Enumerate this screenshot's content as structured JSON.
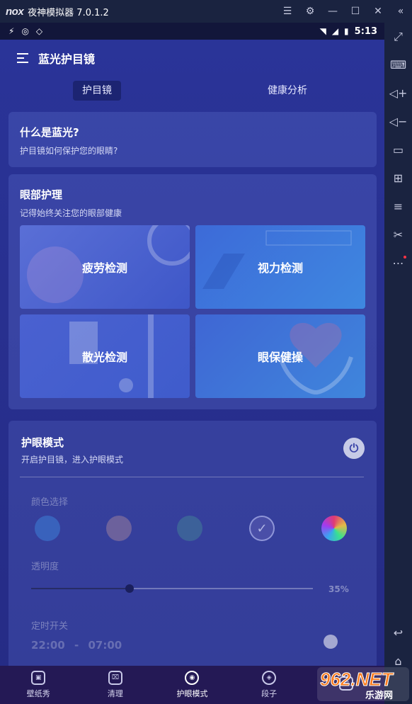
{
  "emulator": {
    "logo": "nox",
    "title": "夜神模拟器 7.0.1.2",
    "window_controls": [
      "menu-icon",
      "settings-icon",
      "minimize-icon",
      "maximize-icon",
      "close-icon",
      "collapse-icon"
    ],
    "side_tools": [
      "fullscreen-icon",
      "keyboard-icon",
      "volume-up-icon",
      "volume-down-icon",
      "screen-icon",
      "apk-install-icon",
      "multi-instance-icon",
      "cut-icon",
      "more-icon",
      "back-icon",
      "home-icon"
    ]
  },
  "status": {
    "time": "5:13"
  },
  "appbar": {
    "title": "蓝光护目镜"
  },
  "tabs": [
    {
      "label": "护目镜"
    },
    {
      "label": "健康分析"
    }
  ],
  "blue_light_card": {
    "title": "什么是蓝光?",
    "subtitle": "护目镜如何保护您的眼睛?"
  },
  "eye_care_card": {
    "title": "眼部护理",
    "subtitle": "记得始终关注您的眼部健康",
    "tiles": [
      {
        "label": "疲劳检测"
      },
      {
        "label": "视力检测"
      },
      {
        "label": "散光检测"
      },
      {
        "label": "眼保健操"
      }
    ]
  },
  "eye_mode_card": {
    "title": "护眼模式",
    "subtitle": "开启护目镜，进入护眼模式",
    "color_label": "颜色选择",
    "swatch_colors": [
      "#3b6cc4",
      "#7a6a9c",
      "#3f6a98",
      "#4a4fa8",
      "rainbow"
    ],
    "opacity_label": "透明度",
    "opacity_value": "35%",
    "opacity_fraction": 0.35,
    "timer_label": "定时开关",
    "timer_start": "22:00",
    "timer_sep": "-",
    "timer_end": "07:00"
  },
  "bottom_nav": [
    {
      "label": "壁纸秀",
      "icon": "wallpaper-icon"
    },
    {
      "label": "清理",
      "icon": "clean-basket-icon"
    },
    {
      "label": "护眼模式",
      "icon": "eye-mode-icon"
    },
    {
      "label": "段子",
      "icon": "jokes-icon"
    },
    {
      "label": "",
      "icon": "tools-icon"
    }
  ],
  "watermark": {
    "text_large": "962.NET",
    "text_small": "乐游网"
  }
}
